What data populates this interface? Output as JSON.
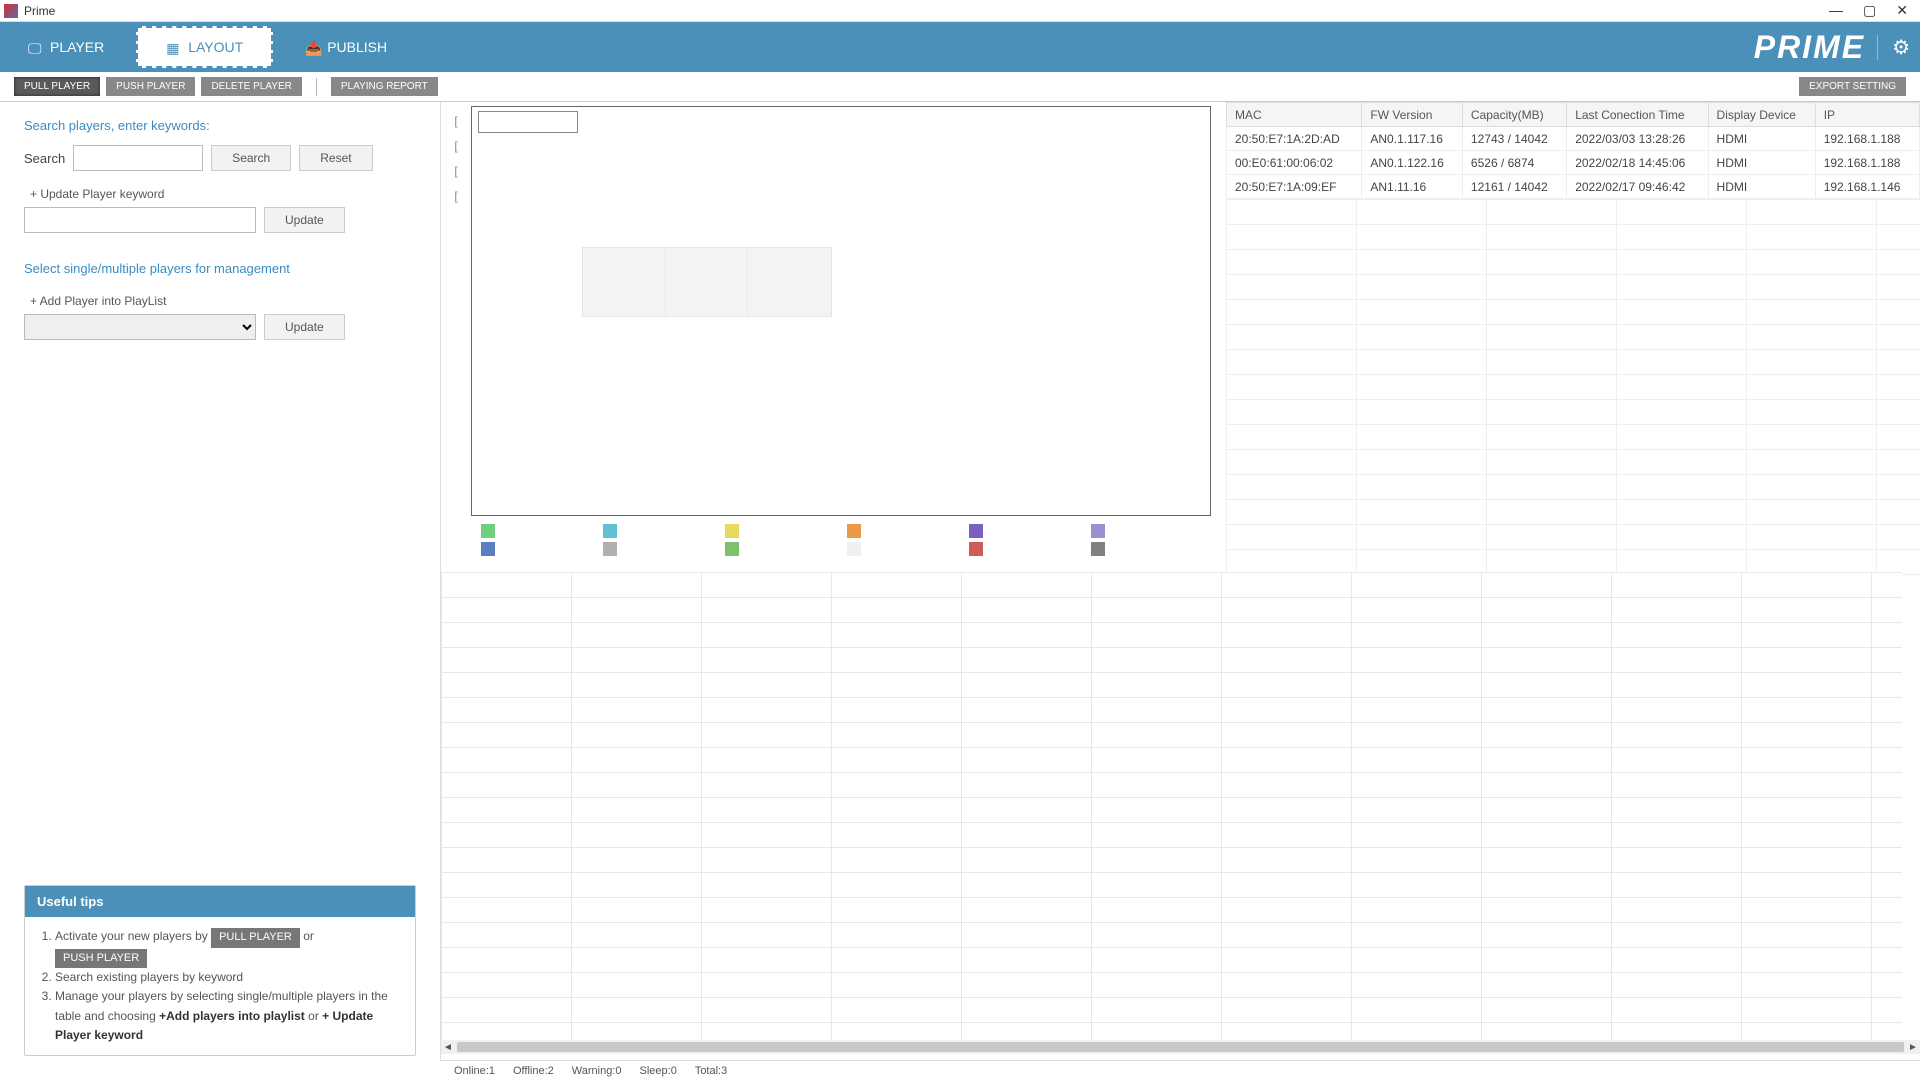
{
  "window": {
    "title": "Prime"
  },
  "nav": {
    "player": "PLAYER",
    "layout": "LAYOUT",
    "publish": "PUBLISH",
    "brand": "PRIME"
  },
  "toolbar": {
    "pull": "PULL PLAYER",
    "push": "PUSH PLAYER",
    "delete": "DELETE PLAYER",
    "report": "PLAYING REPORT",
    "export": "EXPORT SETTING"
  },
  "sidebar": {
    "search_players_label": "Search players, enter keywords:",
    "search_label": "Search",
    "search_btn": "Search",
    "reset_btn": "Reset",
    "update_keyword_label": "+ Update Player keyword",
    "update_btn": "Update",
    "manage_label": "Select single/multiple players for management",
    "add_playlist_label": "+ Add Player into PlayList"
  },
  "tips": {
    "title": "Useful tips",
    "t1_a": "Activate your new players by",
    "t1_pull": "PULL PLAYER",
    "t1_or": "or",
    "t1_push": "PUSH PLAYER",
    "t2": "Search existing players by keyword",
    "t3_a": "Manage your players by selecting single/multiple players in the table and choosing",
    "t3_add": "+Add players into playlist",
    "t3_or": "or",
    "t3_upd": "+ Update Player keyword"
  },
  "table": {
    "headers": {
      "mac": "MAC",
      "fw": "FW Version",
      "cap": "Capacity(MB)",
      "last": "Last Conection Time",
      "disp": "Display Device",
      "ip": "IP"
    },
    "rows": [
      {
        "mac": "20:50:E7:1A:2D:AD",
        "fw": "AN0.1.117.16",
        "cap": "12743 / 14042",
        "last": "2022/03/03 13:28:26",
        "disp": "HDMI",
        "ip": "192.168.1.188"
      },
      {
        "mac": "00:E0:61:00:06:02",
        "fw": "AN0.1.122.16",
        "cap": "6526 / 6874",
        "last": "2022/02/18 14:45:06",
        "disp": "HDMI",
        "ip": "192.168.1.188"
      },
      {
        "mac": "20:50:E7:1A:09:EF",
        "fw": "AN1.11.16",
        "cap": "12161 / 14042",
        "last": "2022/02/17 09:46:42",
        "disp": "HDMI",
        "ip": "192.168.1.146"
      }
    ]
  },
  "palette_colors_row1": [
    "#6fcf7f",
    "#5fc0d8",
    "#e8d95a",
    "#e89a4a",
    "#7a5fc0",
    "#9a8fd0"
  ],
  "palette_colors_row2": [
    "#5a7fc0",
    "#b0b0b0",
    "#7fc06a",
    "#f0f0f0",
    "#d05a5a",
    "#808080"
  ],
  "status": {
    "online": "Online:1",
    "offline": "Offline:2",
    "warning": "Warning:0",
    "sleep": "Sleep:0",
    "total": "Total:3"
  }
}
